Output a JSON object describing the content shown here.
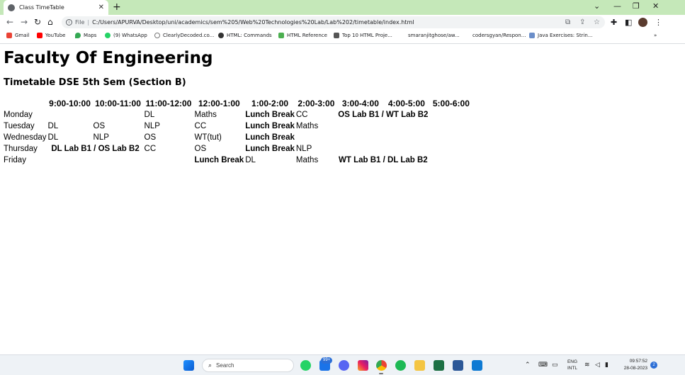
{
  "browser": {
    "tab_title": "Class TimeTable",
    "tab_close": "✕",
    "new_tab": "+",
    "url_prefix": "File",
    "url": "C:/Users/APURVA/Desktop/uni/academics/sem%205/Web%20Technologies%20Lab/Lab%202/timetable/index.html",
    "more_bookmarks": "»",
    "bookmarks": [
      {
        "label": "Gmail",
        "color": "#ea4335"
      },
      {
        "label": "YouTube",
        "color": "#ff0000"
      },
      {
        "label": "Maps",
        "color": "#34a853"
      },
      {
        "label": "(9) WhatsApp",
        "color": "#25d366"
      },
      {
        "label": "ClearlyDecoded.co...",
        "color": "#777777"
      },
      {
        "label": "HTML: Commands",
        "color": "#333333"
      },
      {
        "label": "HTML Reference",
        "color": "#4caf50"
      },
      {
        "label": "Top 10 HTML Proje...",
        "color": "#555555"
      },
      {
        "label": "smaranjitghose/aw...",
        "color": "#ffffff"
      },
      {
        "label": "codersgyan/Respon...",
        "color": "#ffffff"
      },
      {
        "label": "Java Exercises: Strin...",
        "color": "#6b8ec9"
      }
    ]
  },
  "page": {
    "title": "Faculty Of Engineering",
    "subtitle": "Timetable DSE 5th Sem (Section B)"
  },
  "timetable": {
    "headers": [
      "",
      "9:00-10:00",
      "10:00-11:00",
      "11:00-12:00",
      "12:00-1:00",
      "1:00-2:00",
      "2:00-3:00",
      "3:00-4:00",
      "4:00-5:00",
      "5:00-6:00"
    ],
    "rows": {
      "monday": {
        "day": "Monday",
        "c3": "DL",
        "c4": "Maths",
        "c5": "Lunch Break",
        "c6": "CC",
        "lab": "OS Lab B1 / WT Lab B2"
      },
      "tuesday": {
        "day": "Tuesday",
        "c1": "DL",
        "c2": "OS",
        "c3": "NLP",
        "c4": "CC",
        "c5": "Lunch Break",
        "c6": "Maths"
      },
      "wednesday": {
        "day": "Wednesday",
        "c1": "DL",
        "c2": "NLP",
        "c3": "OS",
        "c4": "WT(tut)",
        "c5": "Lunch Break"
      },
      "thursday": {
        "day": "Thursday",
        "lab": "DL Lab B1 / OS Lab B2",
        "c3": "CC",
        "c4": "OS",
        "c5": "Lunch Break",
        "c6": "NLP"
      },
      "friday": {
        "day": "Friday",
        "c4": "Lunch Break",
        "c5": "DL",
        "c6": "Maths",
        "lab": "WT Lab B1 / DL Lab B2"
      }
    }
  },
  "taskbar": {
    "search_placeholder": "Search",
    "mail_badge": "99+",
    "lang_line1": "ENG",
    "lang_line2": "INTL",
    "time": "09:57:52",
    "date": "28-08-2023",
    "notifications": "2"
  }
}
